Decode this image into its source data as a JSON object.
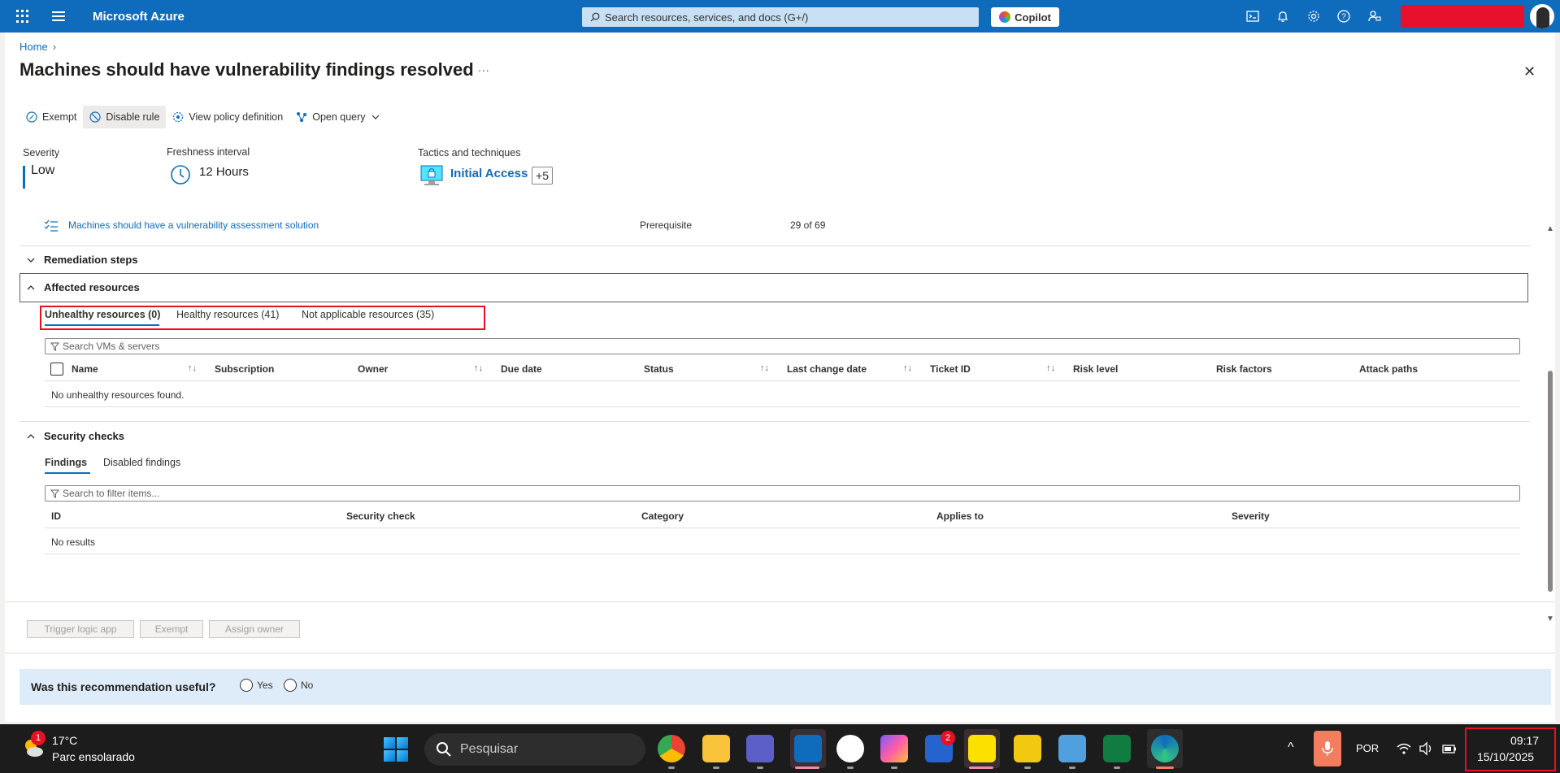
{
  "topbar": {
    "brand": "Microsoft Azure",
    "search_placeholder": "Search resources, services, and docs (G+/)",
    "copilot_label": "Copilot"
  },
  "breadcrumb": {
    "home": "Home"
  },
  "page": {
    "title": "Machines should have vulnerability findings resolved",
    "more": "..."
  },
  "toolbar": {
    "exempt": "Exempt",
    "disable_rule": "Disable rule",
    "view_policy": "View policy definition",
    "open_query": "Open query"
  },
  "meta": {
    "severity_label": "Severity",
    "severity_value": "Low",
    "freshness_label": "Freshness interval",
    "freshness_value": "12 Hours",
    "tactics_label": "Tactics and techniques",
    "tactics_value": "Initial Access",
    "tactics_more": "+5"
  },
  "prerequisite": {
    "link": "Machines should have a vulnerability assessment solution",
    "type": "Prerequisite",
    "count": "29 of 69"
  },
  "sections": {
    "remediation": "Remediation steps",
    "affected": "Affected resources",
    "security_checks": "Security checks"
  },
  "affected_tabs": [
    {
      "label": "Unhealthy resources (0)",
      "selected": true
    },
    {
      "label": "Healthy resources (41)",
      "selected": false
    },
    {
      "label": "Not applicable resources (35)",
      "selected": false
    }
  ],
  "resources_filter_placeholder": "Search VMs & servers",
  "resources_columns": [
    "Name",
    "Subscription",
    "Owner",
    "Due date",
    "Status",
    "Last change date",
    "Ticket ID",
    "Risk level",
    "Risk factors",
    "Attack paths"
  ],
  "resources_empty": "No unhealthy resources found.",
  "checks_tabs": [
    {
      "label": "Findings",
      "selected": true
    },
    {
      "label": "Disabled findings",
      "selected": false
    }
  ],
  "checks_filter_placeholder": "Search to filter items...",
  "checks_columns": [
    "ID",
    "Security check",
    "Category",
    "Applies to",
    "Severity"
  ],
  "checks_empty": "No results",
  "footer_buttons": {
    "trigger": "Trigger logic app",
    "exempt": "Exempt",
    "assign": "Assign owner"
  },
  "feedback": {
    "question": "Was this recommendation useful?",
    "yes": "Yes",
    "no": "No"
  },
  "taskbar": {
    "weather_badge": "1",
    "weather_temp": "17°C",
    "weather_desc": "Parc ensolarado",
    "search": "Pesquisar",
    "todo_badge": "2",
    "lang": "POR",
    "time": "09:17",
    "date": "15/10/2025"
  },
  "colors": {
    "accent": "#0f6cbd",
    "highlight": "#e81123",
    "feedback_bg": "#deecf9"
  }
}
